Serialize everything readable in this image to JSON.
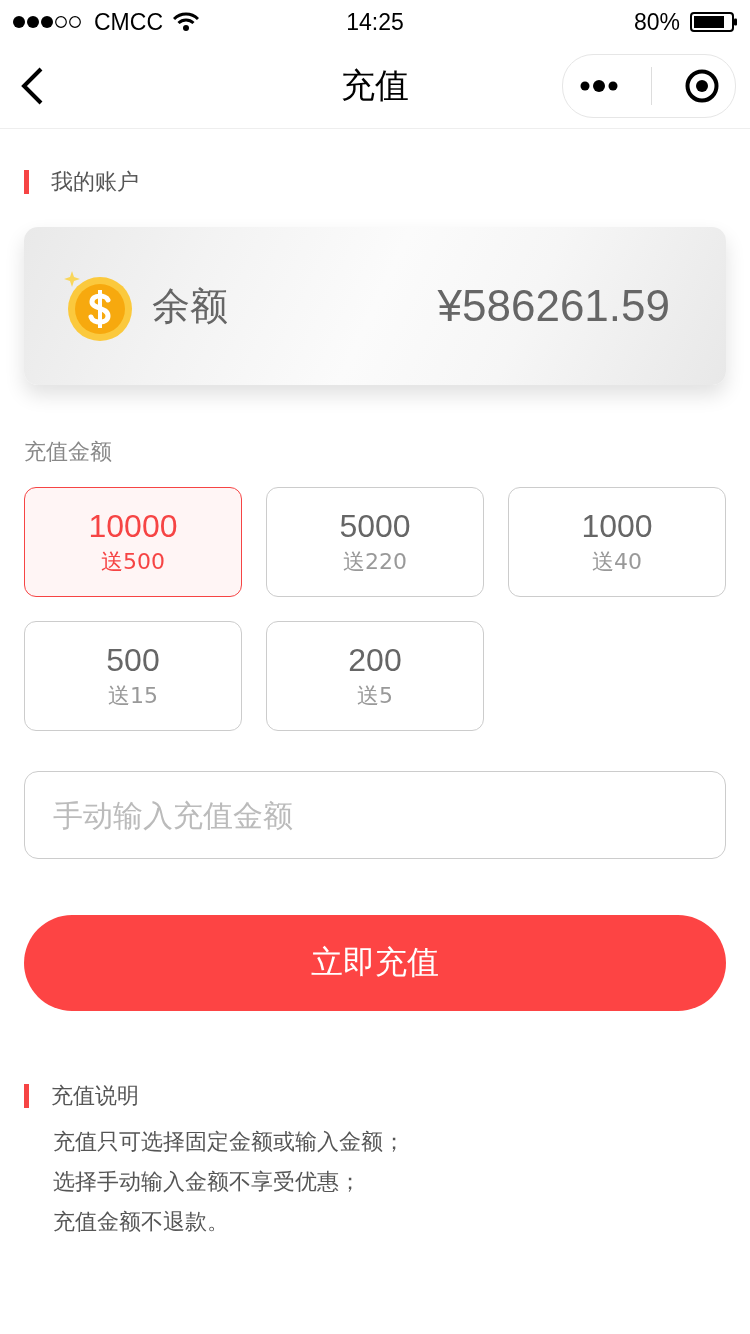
{
  "status_bar": {
    "carrier": "CMCC",
    "time": "14:25",
    "battery": "80%"
  },
  "nav": {
    "title": "充值"
  },
  "account": {
    "heading": "我的账户",
    "balance_label": "余额",
    "balance": "¥586261.59"
  },
  "recharge": {
    "heading": "充值金额",
    "options": [
      {
        "amount": "10000",
        "bonus": "送500",
        "selected": true
      },
      {
        "amount": "5000",
        "bonus": "送220",
        "selected": false
      },
      {
        "amount": "1000",
        "bonus": "送40",
        "selected": false
      },
      {
        "amount": "500",
        "bonus": "送15",
        "selected": false
      },
      {
        "amount": "200",
        "bonus": "送5",
        "selected": false
      }
    ],
    "input": {
      "placeholder": "手动输入充值金额"
    },
    "submit": "立即充值"
  },
  "notes": {
    "heading": "充值说明",
    "lines": [
      "充值只可选择固定金额或输入金额；",
      "选择手动输入金额不享受优惠；",
      "充值金额不退款。"
    ]
  }
}
